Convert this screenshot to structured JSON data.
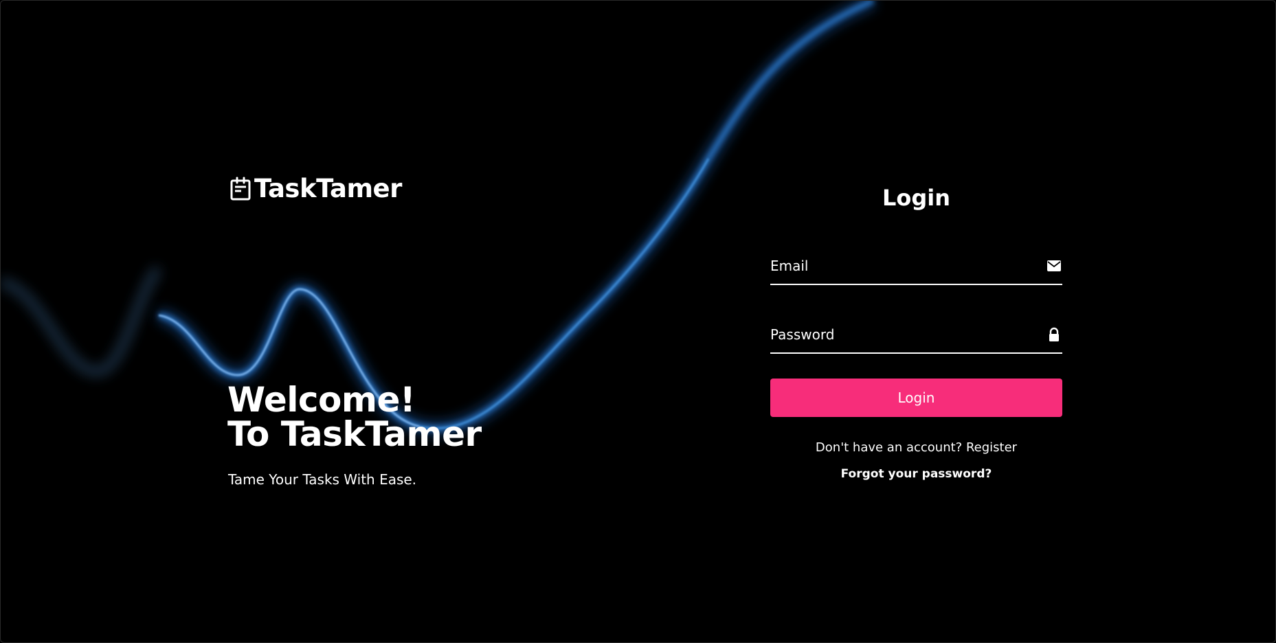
{
  "brand": {
    "name": "TaskTamer",
    "icon": "calendar-note-icon"
  },
  "hero": {
    "line1": "Welcome!",
    "line2": "To TaskTamer",
    "tagline": "Tame Your Tasks With Ease."
  },
  "login": {
    "title": "Login",
    "email_placeholder": "Email",
    "email_icon": "envelope-icon",
    "password_placeholder": "Password",
    "password_icon": "lock-icon",
    "button_label": "Login",
    "register_prompt": "Don't have an account?",
    "register_link": "Register",
    "forgot_link": "Forgot your password?"
  },
  "colors": {
    "background": "#000000",
    "accent": "#f72d7a",
    "wave": "#1e6fd9",
    "text": "#ffffff"
  }
}
